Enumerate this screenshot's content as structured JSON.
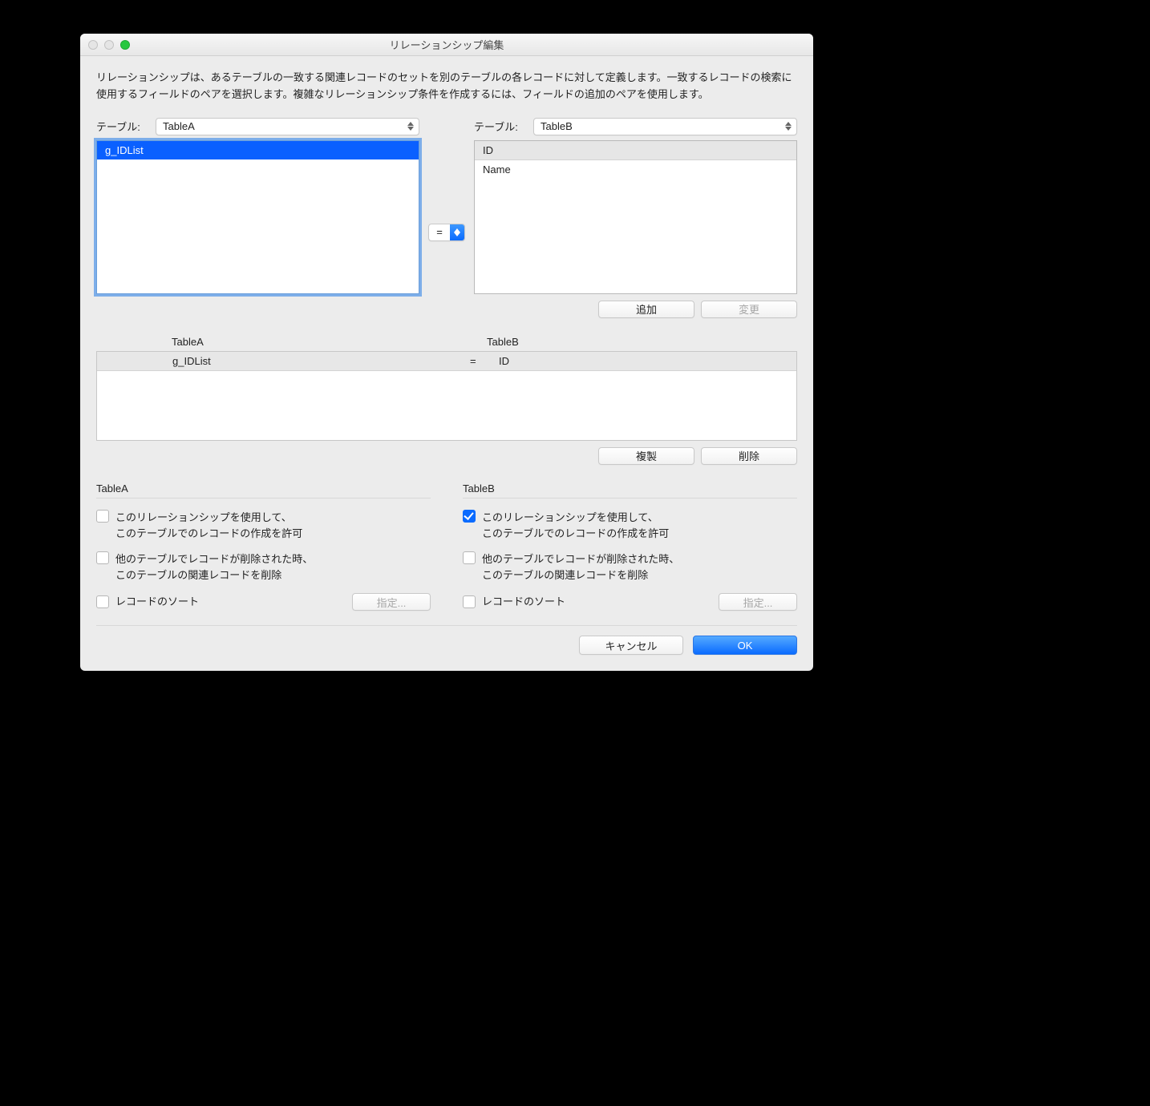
{
  "window": {
    "title": "リレーションシップ編集"
  },
  "description": "リレーションシップは、あるテーブルの一致する関連レコードのセットを別のテーブルの各レコードに対して定義します。一致するレコードの検索に使用するフィールドのペアを選択します。複雑なリレーションシップ条件を作成するには、フィールドの追加のペアを使用します。",
  "labels": {
    "table": "テーブル:",
    "add": "追加",
    "change": "変更",
    "duplicate": "複製",
    "delete": "削除",
    "spec": "指定...",
    "cancel": "キャンセル",
    "ok": "OK"
  },
  "left": {
    "table_name": "TableA",
    "fields": [
      "g_IDList"
    ],
    "selected_index": 0
  },
  "right": {
    "table_name": "TableB",
    "fields": [
      "ID",
      "Name"
    ]
  },
  "operator": "=",
  "pair_header": {
    "a": "TableA",
    "b": "TableB"
  },
  "pairs": [
    {
      "a": "g_IDList",
      "op": "=",
      "b": "ID"
    }
  ],
  "options": {
    "a": {
      "title": "TableA",
      "create_line1": "このリレーションシップを使用して、",
      "create_line2": "このテーブルでのレコードの作成を許可",
      "create_checked": false,
      "delete_line1": "他のテーブルでレコードが削除された時、",
      "delete_line2": "このテーブルの関連レコードを削除",
      "delete_checked": false,
      "sort_label": "レコードのソート",
      "sort_checked": false
    },
    "b": {
      "title": "TableB",
      "create_line1": "このリレーションシップを使用して、",
      "create_line2": "このテーブルでのレコードの作成を許可",
      "create_checked": true,
      "delete_line1": "他のテーブルでレコードが削除された時、",
      "delete_line2": "このテーブルの関連レコードを削除",
      "delete_checked": false,
      "sort_label": "レコードのソート",
      "sort_checked": false
    }
  }
}
